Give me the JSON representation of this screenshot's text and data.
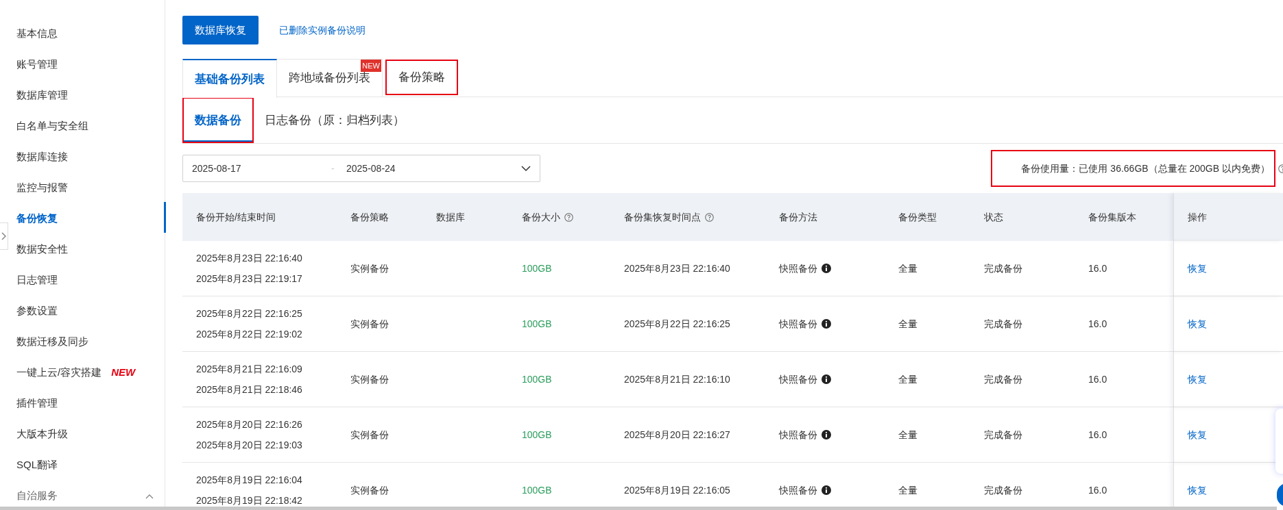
{
  "sidebar": {
    "items": [
      {
        "label": "基本信息",
        "selected": false
      },
      {
        "label": "账号管理",
        "selected": false
      },
      {
        "label": "数据库管理",
        "selected": false
      },
      {
        "label": "白名单与安全组",
        "selected": false
      },
      {
        "label": "数据库连接",
        "selected": false
      },
      {
        "label": "监控与报警",
        "selected": false
      },
      {
        "label": "备份恢复",
        "selected": true
      },
      {
        "label": "数据安全性",
        "selected": false
      },
      {
        "label": "日志管理",
        "selected": false
      },
      {
        "label": "参数设置",
        "selected": false
      },
      {
        "label": "数据迁移及同步",
        "selected": false
      },
      {
        "label": "一键上云/容灾搭建",
        "selected": false,
        "badge": "NEW"
      },
      {
        "label": "插件管理",
        "selected": false
      },
      {
        "label": "大版本升级",
        "selected": false
      },
      {
        "label": "SQL翻译",
        "selected": false
      }
    ],
    "group": {
      "label": "自治服务",
      "expanded": true
    }
  },
  "toolbar": {
    "primary_button": "数据库恢复",
    "link": "已删除实例备份说明"
  },
  "tabs": [
    {
      "label": "基础备份列表",
      "selected": true,
      "highlighted": false
    },
    {
      "label": "跨地域备份列表",
      "selected": false,
      "highlighted": false,
      "badge": "NEW"
    },
    {
      "label": "备份策略",
      "selected": false,
      "highlighted": true
    }
  ],
  "subtabs": [
    {
      "label": "数据备份",
      "selected": true,
      "highlighted": true
    },
    {
      "label": "日志备份（原：归档列表）",
      "selected": false,
      "highlighted": false
    }
  ],
  "date_range": {
    "start": "2025-08-17",
    "separator": "-",
    "end": "2025-08-24"
  },
  "usage": {
    "text": "备份使用量：已使用 36.66GB（总量在 200GB 以内免费）",
    "highlighted": true
  },
  "table": {
    "columns": [
      {
        "label": "备份开始/结束时间",
        "help": false
      },
      {
        "label": "备份策略",
        "help": false
      },
      {
        "label": "数据库",
        "help": false
      },
      {
        "label": "备份大小",
        "help": true
      },
      {
        "label": "备份集恢复时间点",
        "help": true
      },
      {
        "label": "备份方法",
        "help": false
      },
      {
        "label": "备份类型",
        "help": false
      },
      {
        "label": "状态",
        "help": false
      },
      {
        "label": "备份集版本",
        "help": false
      },
      {
        "label": "操作",
        "help": false
      }
    ],
    "rows": [
      {
        "start": "2025年8月23日 22:16:40",
        "end": "2025年8月23日 22:19:17",
        "policy": "实例备份",
        "size": "100GB",
        "restore_point": "2025年8月23日 22:16:40",
        "method": "快照备份",
        "type": "全量",
        "status": "完成备份",
        "version": "16.0",
        "action": "恢复"
      },
      {
        "start": "2025年8月22日 22:16:25",
        "end": "2025年8月22日 22:19:02",
        "policy": "实例备份",
        "size": "100GB",
        "restore_point": "2025年8月22日 22:16:25",
        "method": "快照备份",
        "type": "全量",
        "status": "完成备份",
        "version": "16.0",
        "action": "恢复"
      },
      {
        "start": "2025年8月21日 22:16:09",
        "end": "2025年8月21日 22:18:46",
        "policy": "实例备份",
        "size": "100GB",
        "restore_point": "2025年8月21日 22:16:10",
        "method": "快照备份",
        "type": "全量",
        "status": "完成备份",
        "version": "16.0",
        "action": "恢复"
      },
      {
        "start": "2025年8月20日 22:16:26",
        "end": "2025年8月20日 22:19:03",
        "policy": "实例备份",
        "size": "100GB",
        "restore_point": "2025年8月20日 22:16:27",
        "method": "快照备份",
        "type": "全量",
        "status": "完成备份",
        "version": "16.0",
        "action": "恢复"
      },
      {
        "start": "2025年8月19日 22:16:04",
        "end": "2025年8月19日 22:18:42",
        "policy": "实例备份",
        "size": "100GB",
        "restore_point": "2025年8月19日 22:16:05",
        "method": "快照备份",
        "type": "全量",
        "status": "完成备份",
        "version": "16.0",
        "action": "恢复"
      }
    ]
  }
}
